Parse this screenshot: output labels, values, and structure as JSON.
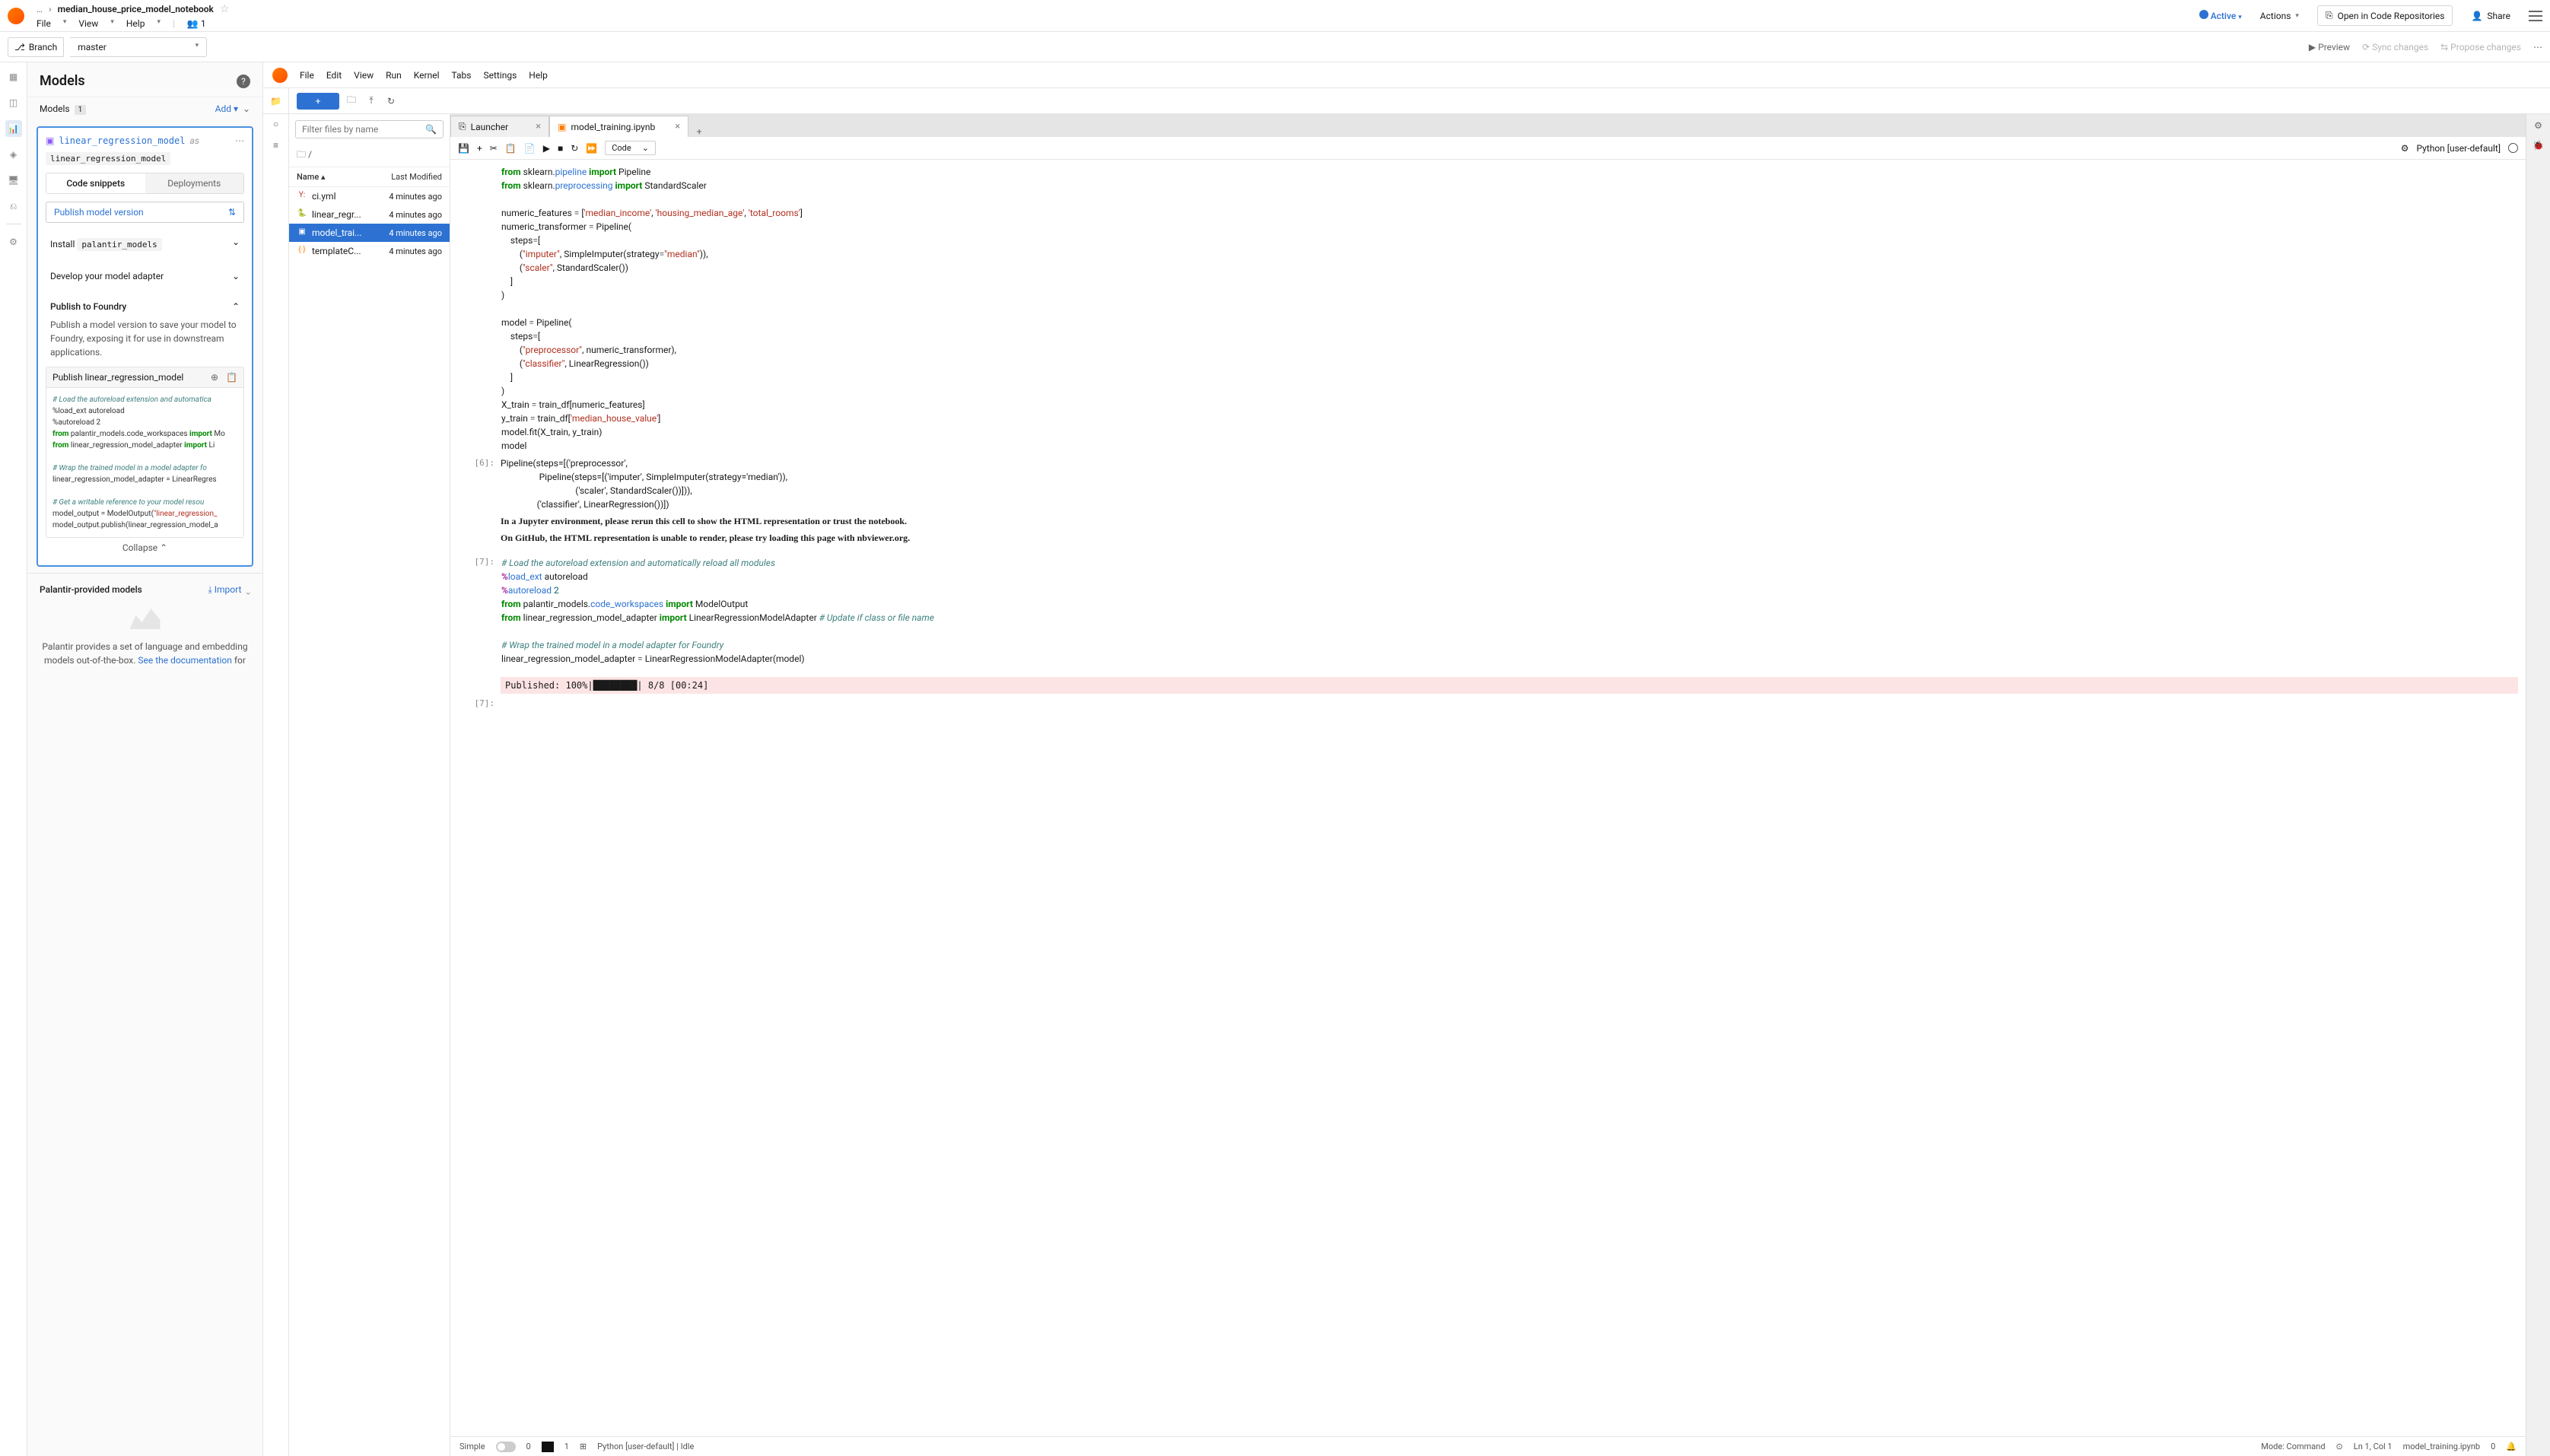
{
  "header": {
    "breadcrumb_ellipsis": "…",
    "title": "median_house_price_model_notebook",
    "menu": [
      "File",
      "View",
      "Help"
    ],
    "auth_count": "1",
    "active": "Active",
    "actions": "Actions",
    "open_repo": "Open in Code Repositories",
    "share": "Share"
  },
  "branch": {
    "label": "Branch",
    "value": "master",
    "preview": "Preview",
    "sync": "Sync changes",
    "propose": "Propose changes"
  },
  "models": {
    "title": "Models",
    "section_label": "Models",
    "count": "1",
    "add": "Add",
    "model_name": "linear_regression_model",
    "model_as": "as",
    "model_alias": "linear_regression_model",
    "tab_code": "Code snippets",
    "tab_deploy": "Deployments",
    "dropdown": "Publish model version",
    "install_label": "Install",
    "install_pkg": "palantir_models",
    "develop": "Develop your model adapter",
    "publish": "Publish to Foundry",
    "publish_desc": "Publish a model version to save your model to Foundry, exposing it for use in downstream applications.",
    "snip_header": "Publish linear_regression_model",
    "collapse": "Collapse",
    "provided_title": "Palantir-provided models",
    "import": "Import",
    "provided_desc_1": "Palantir provides a set of language and embedding models out-of-the-box. ",
    "provided_link": "See the documentation",
    "provided_desc_2": " for"
  },
  "snippet": {
    "l1": "# Load the autoreload extension and automatica",
    "l2": "%load_ext autoreload",
    "l3": "%autoreload 2",
    "l4a": "from",
    "l4b": " palantir_models.code_workspaces ",
    "l4c": "import",
    "l4d": " Mo",
    "l5a": "from",
    "l5b": " linear_regression_model_adapter ",
    "l5c": "import",
    "l5d": " Li",
    "l6": "",
    "l7": "# Wrap the trained model in a model adapter fo",
    "l8": "linear_regression_model_adapter = LinearRegres",
    "l9": "",
    "l10": "# Get a writable reference to your model resou",
    "l11a": "model_output = ModelOutput(",
    "l11b": "\"linear_regression_",
    "l12": "model_output.publish(linear_regression_model_a"
  },
  "nb": {
    "menu": [
      "File",
      "Edit",
      "View",
      "Run",
      "Kernel",
      "Tabs",
      "Settings",
      "Help"
    ],
    "tabs": {
      "launcher": "Launcher",
      "file": "model_training.ipynb"
    },
    "cell_type": "Code",
    "kernel": "Python [user-default]",
    "filter_ph": "Filter files by name",
    "path": "/",
    "cols": {
      "name": "Name",
      "modified": "Last Modified"
    },
    "files": [
      {
        "icon": "Y:",
        "name": "ci.yml",
        "time": "4 minutes ago",
        "color": "#c0392b"
      },
      {
        "icon": "🐍",
        "name": "linear_regr...",
        "time": "4 minutes ago",
        "color": "#2d72d2"
      },
      {
        "icon": "▣",
        "name": "model_trai...",
        "time": "4 minutes ago",
        "color": "#ff7a00",
        "selected": true
      },
      {
        "icon": "{·}",
        "name": "templateC...",
        "time": "4 minutes ago",
        "color": "#ff7a00"
      }
    ]
  },
  "cells": {
    "c1l1a": "from",
    "c1l1b": " sklearn.",
    "c1l1c": "pipeline",
    "c1l1d": " import",
    "c1l1e": " Pipeline",
    "c1l2a": "from",
    "c1l2b": " sklearn.",
    "c1l2c": "preprocessing",
    "c1l2d": " import",
    "c1l2e": " StandardScaler",
    "c1l3": "",
    "c1l4a": "numeric_features ",
    "c1l4b": "=",
    "c1l4c": " [",
    "c1l4d": "'median_income'",
    "c1l4e": ", ",
    "c1l4f": "'housing_median_age'",
    "c1l4g": ", ",
    "c1l4h": "'total_rooms'",
    "c1l4i": "]",
    "c1l5a": "numeric_transformer ",
    "c1l5b": "=",
    "c1l5c": " Pipeline(",
    "c1l6a": "    steps",
    "c1l6b": "=",
    "c1l6c": "[",
    "c1l7a": "        (",
    "c1l7b": "\"imputer\"",
    "c1l7c": ", SimpleImputer(strategy",
    "c1l7d": "=",
    "c1l7e": "\"median\"",
    "c1l7f": ")),",
    "c1l8a": "        (",
    "c1l8b": "\"scaler\"",
    "c1l8c": ", StandardScaler())",
    "c1l9": "    ]",
    "c1l10": ")",
    "c1l11": "",
    "c1l12a": "model ",
    "c1l12b": "=",
    "c1l12c": " Pipeline(",
    "c1l13a": "    steps",
    "c1l13b": "=",
    "c1l13c": "[",
    "c1l14a": "        (",
    "c1l14b": "\"preprocessor\"",
    "c1l14c": ", numeric_transformer),",
    "c1l15a": "        (",
    "c1l15b": "\"classifier\"",
    "c1l15c": ", LinearRegression())",
    "c1l16": "    ]",
    "c1l17": ")",
    "c1l18a": "X_train ",
    "c1l18b": "=",
    "c1l18c": " train_df[numeric_features]",
    "c1l19a": "y_train ",
    "c1l19b": "=",
    "c1l19c": " train_df[",
    "c1l19d": "'median_house_value'",
    "c1l19e": "]",
    "c1l20": "model.fit(X_train, y_train)",
    "c1l21": "model",
    "out6_prompt": "[6]:",
    "out6_1": "Pipeline(steps=[('preprocessor',",
    "out6_2": "                 Pipeline(steps=[('imputer', SimpleImputer(strategy='median')),",
    "out6_3": "                                 ('scaler', StandardScaler())])),",
    "out6_4": "                ('classifier', LinearRegression())])",
    "out6_msg1": "In a Jupyter environment, please rerun this cell to show the HTML representation or trust the notebook.",
    "out6_msg2": "On GitHub, the HTML representation is unable to render, please try loading this page with nbviewer.org.",
    "in7_prompt": "[7]:",
    "c7l1": "# Load the autoreload extension and automatically reload all modules",
    "c7l2a": "%",
    "c7l2b": "load_ext",
    "c7l2c": " autoreload",
    "c7l3a": "%",
    "c7l3b": "autoreload",
    "c7l3c": " 2",
    "c7l4a": "from",
    "c7l4b": " palantir_models.",
    "c7l4c": "code_workspaces",
    "c7l4d": " import",
    "c7l4e": " ModelOutput",
    "c7l5a": "from",
    "c7l5b": " linear_regression_model_adapter ",
    "c7l5c": "import",
    "c7l5d": " LinearRegressionModelAdapter ",
    "c7l5e": "# Update if class or file name",
    "c7l6": "",
    "c7l7": "# Wrap the trained model in a model adapter for Foundry",
    "c7l8a": "linear_regression_model_adapter ",
    "c7l8b": "=",
    "c7l8c": " LinearRegressionModelAdapter(model)",
    "prog": "Published: 100%|████████| 8/8 [00:24]",
    "out7_prompt": "[7]:"
  },
  "status": {
    "simple": "Simple",
    "zero": "0",
    "one": "1",
    "kernel": "Python [user-default] | Idle",
    "mode": "Mode: Command",
    "ln": "Ln 1, Col 1",
    "file": "model_training.ipynb",
    "bell_count": "0"
  }
}
